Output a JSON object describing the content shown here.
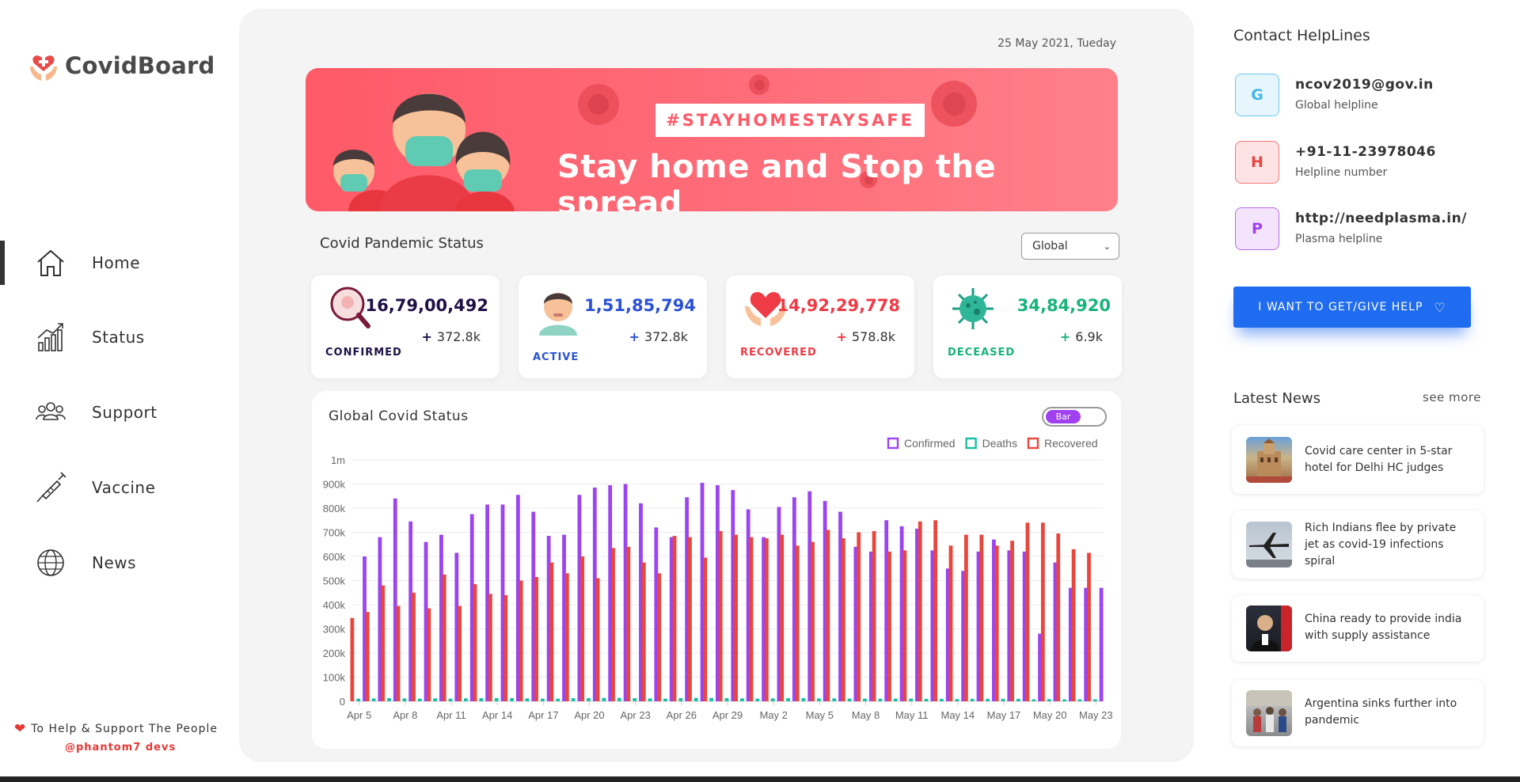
{
  "brand": {
    "name": "CovidBoard"
  },
  "sidebar": {
    "items": [
      {
        "label": "Home",
        "icon": "home-icon"
      },
      {
        "label": "Status",
        "icon": "chart-icon"
      },
      {
        "label": "Support",
        "icon": "people-icon"
      },
      {
        "label": "Vaccine",
        "icon": "syringe-icon"
      },
      {
        "label": "News",
        "icon": "globe-icon"
      }
    ],
    "footer_text": "To Help & Support The People",
    "footer_credit": "@phantom7 devs"
  },
  "header": {
    "date": "25 May 2021, Tueday"
  },
  "banner": {
    "tag": "#STAYHOMESTAYSAFE",
    "headline": "Stay home and Stop the spread"
  },
  "status": {
    "title": "Covid Pandemic Status",
    "region_selected": "Global",
    "cards": [
      {
        "label": "CONFIRMED",
        "value": "16,79,00,492",
        "delta": "372.8k",
        "color": "#1f1146",
        "label_color": "#1f1146"
      },
      {
        "label": "ACTIVE",
        "value": "1,51,85,794",
        "delta": "372.8k",
        "color": "#2a52d6",
        "label_color": "#2a52d6"
      },
      {
        "label": "RECOVERED",
        "value": "14,92,29,778",
        "delta": "578.8k",
        "color": "#ef3b46",
        "label_color": "#ef3b46"
      },
      {
        "label": "DECEASED",
        "value": "34,84,920",
        "delta": "6.9k",
        "color": "#19b37c",
        "label_color": "#19b37c"
      }
    ]
  },
  "chart": {
    "title": "Global Covid Status",
    "toggle_label": "Bar"
  },
  "chart_data": {
    "type": "bar",
    "legend_position": "top-right",
    "grid": true,
    "ylim": [
      0,
      1000000
    ],
    "y_ticks": [
      "0",
      "100k",
      "200k",
      "300k",
      "400k",
      "500k",
      "600k",
      "700k",
      "800k",
      "900k",
      "1m"
    ],
    "x_tick_labels": [
      "Apr 5",
      "Apr 8",
      "Apr 11",
      "Apr 14",
      "Apr 17",
      "Apr 20",
      "Apr 23",
      "Apr 26",
      "Apr 29",
      "May 2",
      "May 5",
      "May 8",
      "May 11",
      "May 14",
      "May 17",
      "May 20",
      "May 23"
    ],
    "categories": [
      "Apr 5",
      "Apr 6",
      "Apr 7",
      "Apr 8",
      "Apr 9",
      "Apr 10",
      "Apr 11",
      "Apr 12",
      "Apr 13",
      "Apr 14",
      "Apr 15",
      "Apr 16",
      "Apr 17",
      "Apr 18",
      "Apr 19",
      "Apr 20",
      "Apr 21",
      "Apr 22",
      "Apr 23",
      "Apr 24",
      "Apr 25",
      "Apr 26",
      "Apr 27",
      "Apr 28",
      "Apr 29",
      "Apr 30",
      "May 1",
      "May 2",
      "May 3",
      "May 4",
      "May 5",
      "May 6",
      "May 7",
      "May 8",
      "May 9",
      "May 10",
      "May 11",
      "May 12",
      "May 13",
      "May 14",
      "May 15",
      "May 16",
      "May 17",
      "May 18",
      "May 19",
      "May 20",
      "May 21",
      "May 22",
      "May 23"
    ],
    "series": [
      {
        "name": "Confirmed",
        "color": "#9b45f0",
        "values": [
          600000,
          680000,
          840000,
          745000,
          660000,
          690000,
          615000,
          775000,
          815000,
          815000,
          855000,
          785000,
          685000,
          690000,
          855000,
          885000,
          895000,
          900000,
          820000,
          720000,
          680000,
          845000,
          905000,
          895000,
          875000,
          795000,
          680000,
          805000,
          845000,
          870000,
          830000,
          785000,
          640000,
          620000,
          750000,
          725000,
          715000,
          625000,
          550000,
          540000,
          620000,
          670000,
          625000,
          620000,
          280000,
          575000,
          470000,
          470000,
          470000
        ]
      },
      {
        "name": "Deaths",
        "color": "#17c0a4",
        "values": [
          11000,
          12000,
          13000,
          12000,
          11000,
          12000,
          11000,
          12000,
          13000,
          13000,
          13000,
          12000,
          11000,
          11000,
          13000,
          13000,
          14000,
          14000,
          13000,
          12000,
          11000,
          13000,
          14000,
          14000,
          13000,
          12000,
          11000,
          12000,
          13000,
          13000,
          12000,
          12000,
          11000,
          11000,
          11000,
          11000,
          11000,
          10000,
          10000,
          9000,
          10000,
          10000,
          10000,
          10000,
          8000,
          9000,
          8000,
          8000,
          8000
        ]
      },
      {
        "name": "Recovered",
        "color": "#e8473d",
        "values": [
          345000,
          370000,
          480000,
          395000,
          450000,
          385000,
          525000,
          395000,
          485000,
          445000,
          440000,
          500000,
          515000,
          575000,
          530000,
          600000,
          510000,
          635000,
          640000,
          575000,
          530000,
          685000,
          680000,
          595000,
          705000,
          690000,
          680000,
          675000,
          690000,
          645000,
          660000,
          710000,
          675000,
          700000,
          705000,
          620000,
          625000,
          745000,
          750000,
          645000,
          690000,
          690000,
          645000,
          665000,
          740000,
          740000,
          695000,
          630000,
          615000
        ]
      }
    ]
  },
  "contacts": {
    "title": "Contact HelpLines",
    "items": [
      {
        "letter": "G",
        "main": "ncov2019@gov.in",
        "sub": "Global helpline",
        "bg": "#e7f6fc",
        "border": "#6dc9ec",
        "fg": "#43b7e6"
      },
      {
        "letter": "H",
        "main": "+91-11-23978046",
        "sub": "Helpline number",
        "bg": "#fde3e3",
        "border": "#ef7a7a",
        "fg": "#e64545"
      },
      {
        "letter": "P",
        "main": "http://needplasma.in/",
        "sub": "Plasma helpline",
        "bg": "#f3e4fc",
        "border": "#b56ee8",
        "fg": "#a040f0"
      }
    ],
    "cta_label": "I WANT TO GET/GIVE HELP"
  },
  "news": {
    "title": "Latest News",
    "see_more": "see more",
    "items": [
      {
        "text": "Covid care center in 5-star hotel for Delhi HC judges",
        "thumb": "hotel-thumbnail"
      },
      {
        "text": "Rich Indians flee by private jet as covid-19 infections spiral",
        "thumb": "jet-thumbnail"
      },
      {
        "text": "China ready to provide india with supply assistance",
        "thumb": "official-thumbnail"
      },
      {
        "text": "Argentina sinks further into pandemic",
        "thumb": "street-thumbnail"
      }
    ]
  }
}
